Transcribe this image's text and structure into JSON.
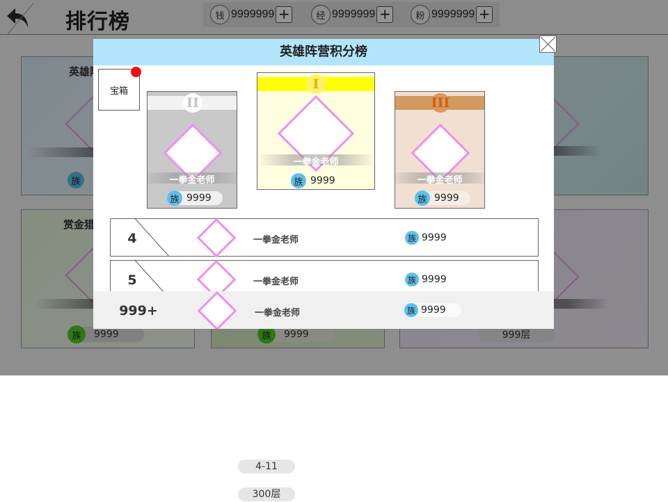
{
  "header": {
    "title": "排行榜",
    "currencies": [
      {
        "icon_label": "钱",
        "value": "9999999",
        "plus": "+"
      },
      {
        "icon_label": "经",
        "value": "9999999",
        "plus": "+"
      },
      {
        "icon_label": "粉",
        "value": "9999999",
        "plus": "+"
      }
    ]
  },
  "background": {
    "cards": [
      {
        "title": "英雄阵",
        "score": ""
      },
      {
        "title": "",
        "score": ""
      },
      {
        "title": "",
        "score": ""
      },
      {
        "title": "赏金猎",
        "score": "9999"
      },
      {
        "title": "",
        "score": "9999"
      },
      {
        "title": "",
        "score": "999层"
      }
    ],
    "clan_label": "族"
  },
  "modal": {
    "title": "英雄阵营积分榜",
    "chest_label": "宝箱",
    "top3": [
      {
        "rank": 1,
        "medal": "I",
        "name": "一拳金老师",
        "clan": "族",
        "score": "9999",
        "band_color": "#ffff00",
        "bg_color": "#ffffe0",
        "medal_color": "#e8c000"
      },
      {
        "rank": 2,
        "medal": "II",
        "name": "一拳金老师",
        "clan": "族",
        "score": "9999",
        "band_color": "#f2f2f2",
        "bg_color": "#c8c8c8",
        "medal_color": "#c4c4c4"
      },
      {
        "rank": 3,
        "medal": "III",
        "name": "一拳金老师",
        "clan": "族",
        "score": "9999",
        "band_color": "#d29a60",
        "bg_color": "#f1e0d2",
        "medal_color": "#d07a28"
      }
    ],
    "rows": [
      {
        "rank": "4",
        "name": "一拳金老师",
        "clan": "族",
        "score": "9999"
      },
      {
        "rank": "5",
        "name": "一拳金老师",
        "clan": "族",
        "score": "9999"
      }
    ],
    "self_row": {
      "rank": "999+",
      "name": "一拳金老师",
      "clan": "族",
      "score": "9999"
    }
  },
  "floating": {
    "range_label": "4-11",
    "floor_label": "300层"
  }
}
